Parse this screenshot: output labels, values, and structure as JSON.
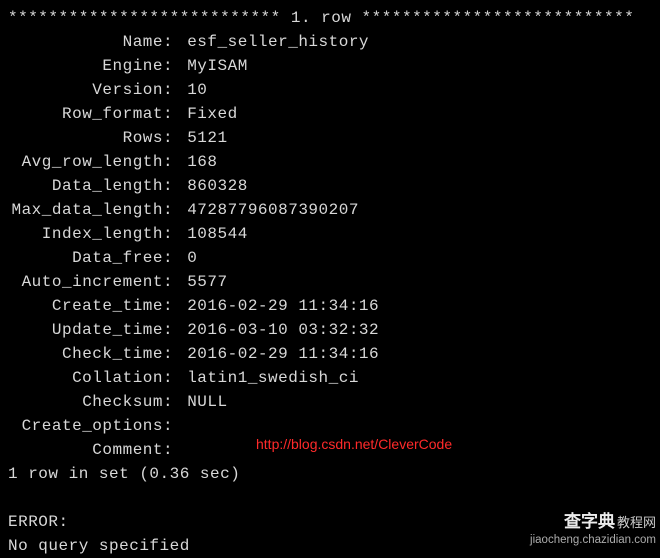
{
  "header": "*************************** 1. row ***************************",
  "fields": [
    {
      "label": "Name",
      "value": "esf_seller_history"
    },
    {
      "label": "Engine",
      "value": "MyISAM"
    },
    {
      "label": "Version",
      "value": "10"
    },
    {
      "label": "Row_format",
      "value": "Fixed"
    },
    {
      "label": "Rows",
      "value": "5121"
    },
    {
      "label": "Avg_row_length",
      "value": "168"
    },
    {
      "label": "Data_length",
      "value": "860328"
    },
    {
      "label": "Max_data_length",
      "value": "47287796087390207"
    },
    {
      "label": "Index_length",
      "value": "108544"
    },
    {
      "label": "Data_free",
      "value": "0"
    },
    {
      "label": "Auto_increment",
      "value": "5577"
    },
    {
      "label": "Create_time",
      "value": "2016-02-29 11:34:16"
    },
    {
      "label": "Update_time",
      "value": "2016-03-10 03:32:32"
    },
    {
      "label": "Check_time",
      "value": "2016-02-29 11:34:16"
    },
    {
      "label": "Collation",
      "value": "latin1_swedish_ci"
    },
    {
      "label": "Checksum",
      "value": "NULL"
    },
    {
      "label": "Create_options",
      "value": ""
    },
    {
      "label": "Comment",
      "value": ""
    }
  ],
  "summary": "1 row in set (0.36 sec)",
  "error_label": "ERROR:",
  "error_msg": "No query specified",
  "watermark_red": "http://blog.csdn.net/CleverCode",
  "watermark_corner_cn": "查字典",
  "watermark_corner_tag": "教程网",
  "watermark_corner_url": "jiaocheng.chazidian.com"
}
